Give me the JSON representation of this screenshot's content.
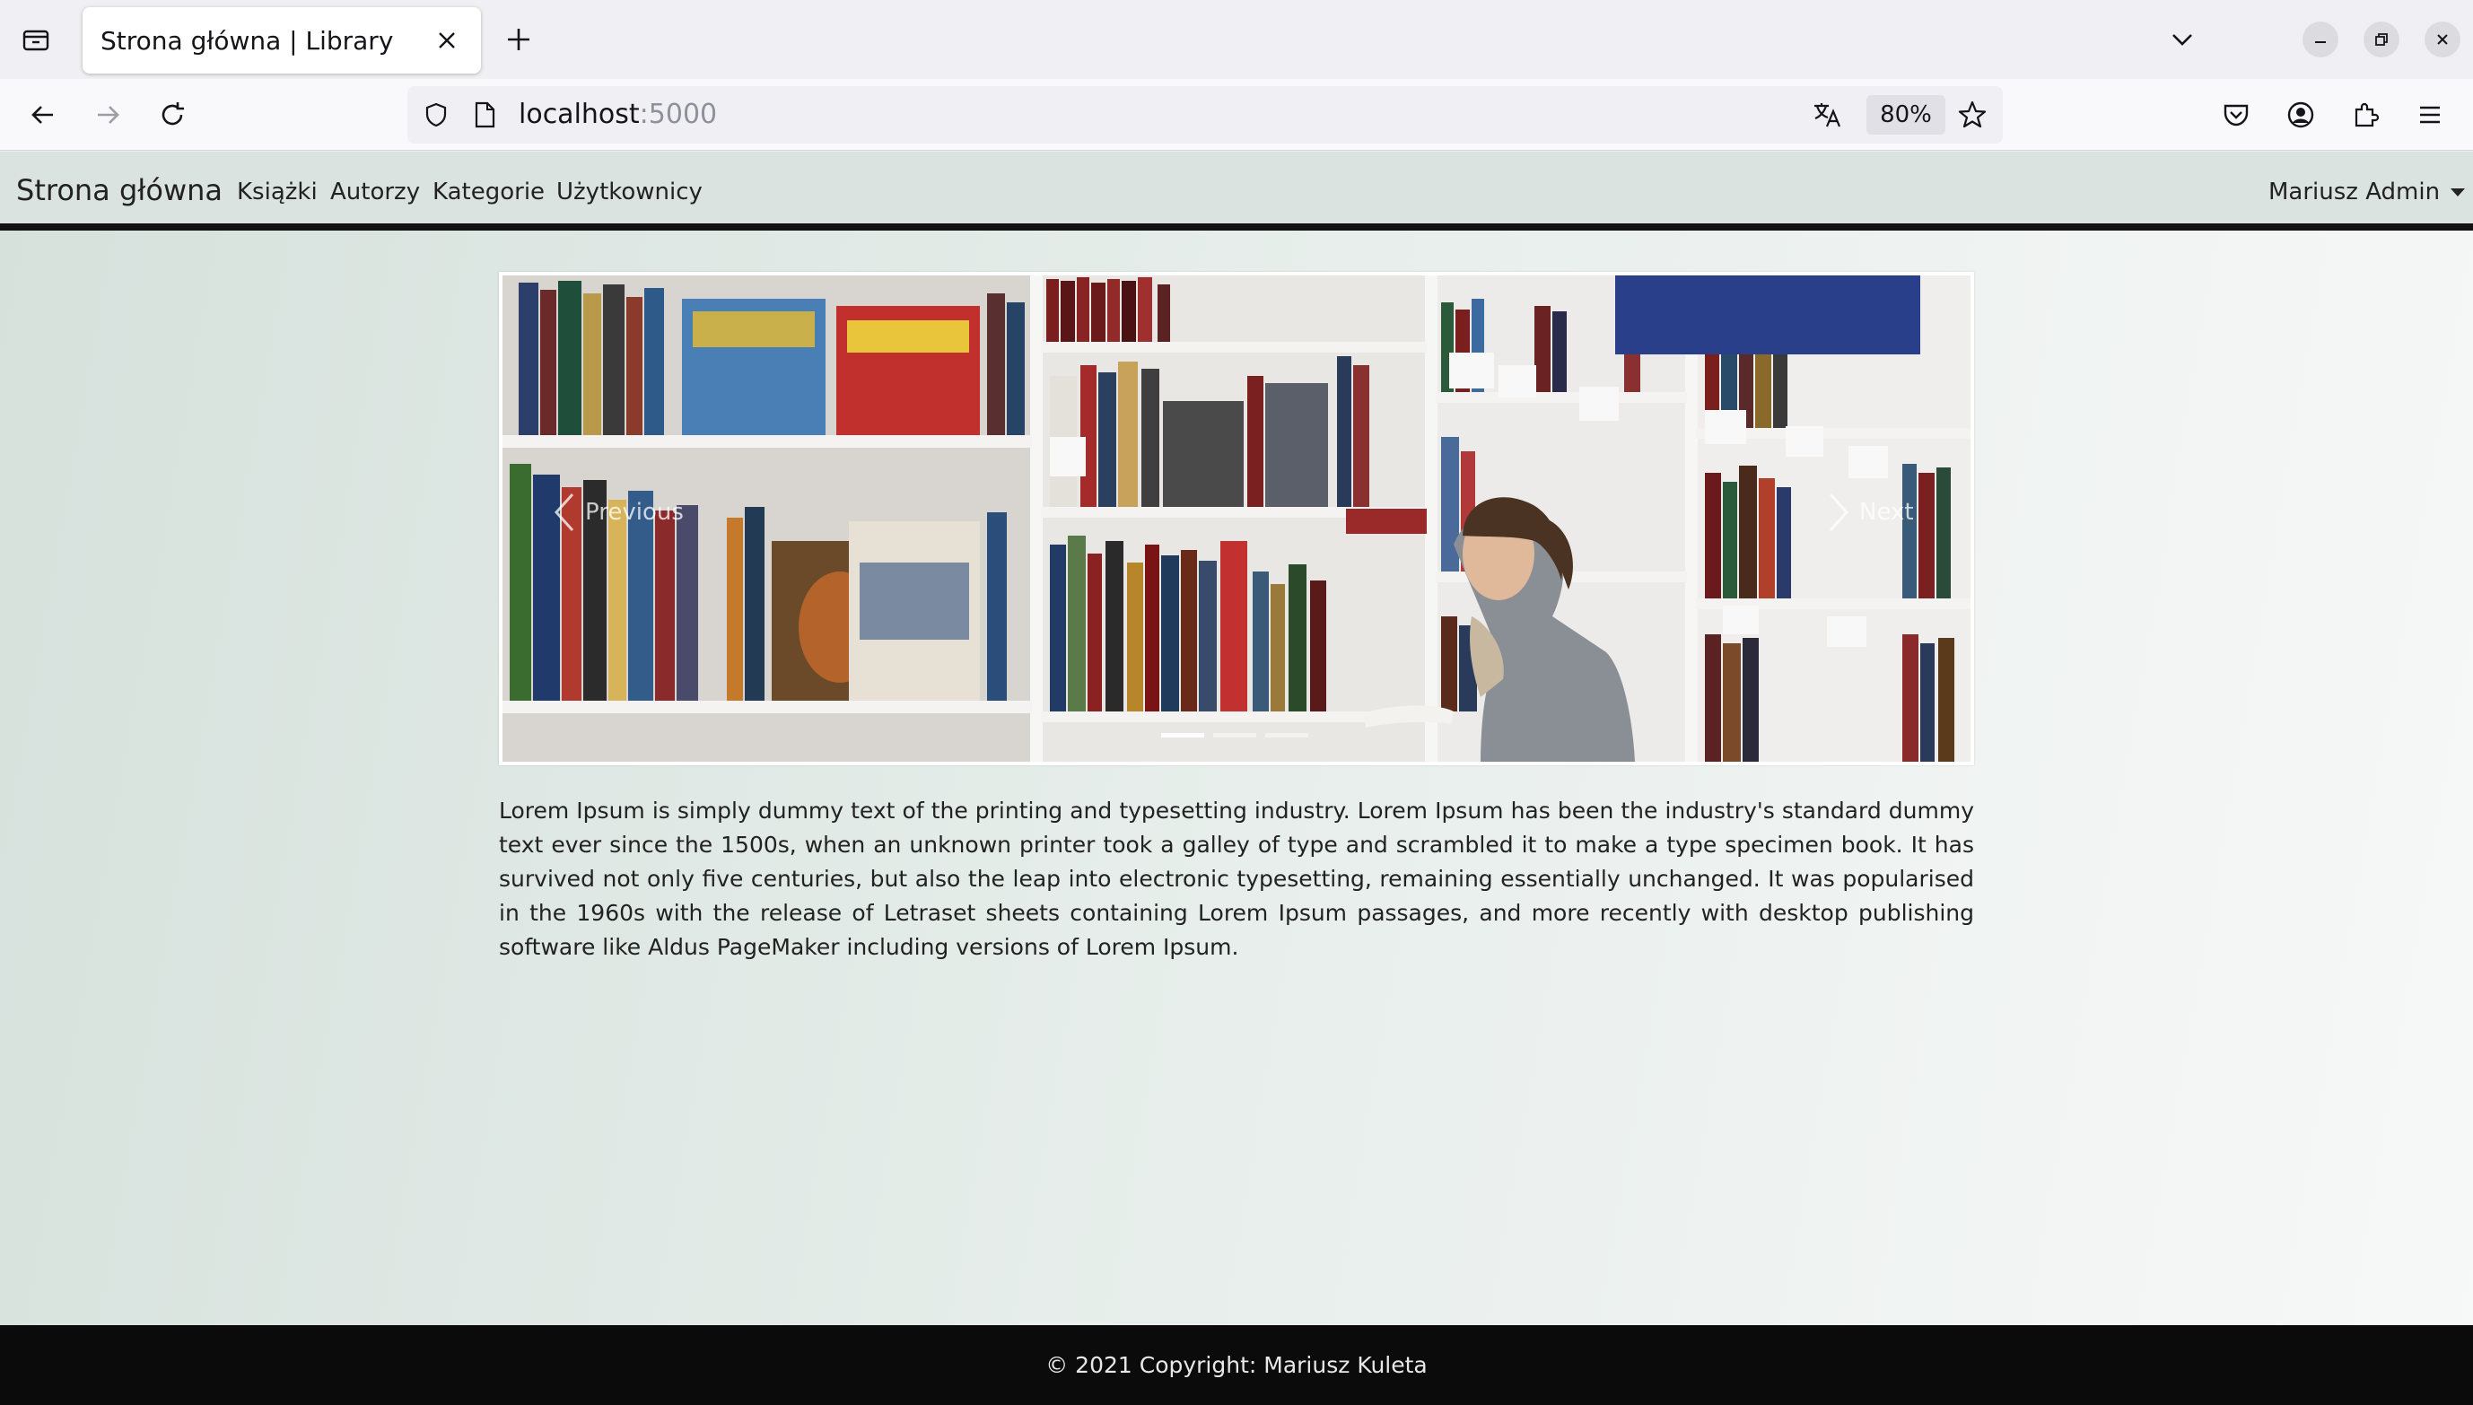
{
  "browser": {
    "tab_title": "Strona główna | Library",
    "url_host": "localhost",
    "url_port": ":5000",
    "zoom": "80%",
    "icons": [
      "tab-list-icon",
      "close-icon",
      "plus-icon",
      "chevron-down-icon",
      "minimize-icon",
      "restore-icon",
      "close-window-icon",
      "back-icon",
      "forward-icon",
      "reload-icon",
      "shield-icon",
      "page-icon",
      "translate-icon",
      "star-icon",
      "pocket-icon",
      "account-icon",
      "extensions-icon",
      "menu-icon"
    ]
  },
  "site": {
    "brand": "Strona główna",
    "nav": [
      "Książki",
      "Autorzy",
      "Kategorie",
      "Użytkownicy"
    ],
    "user": "Mariusz Admin"
  },
  "carousel": {
    "prev_label": "Previous",
    "next_label": "Next",
    "slide_count": 3,
    "active_slide": 1
  },
  "content": {
    "paragraph": "Lorem Ipsum is simply dummy text of the printing and typesetting industry. Lorem Ipsum has been the industry's standard dummy text ever since the 1500s, when an unknown printer took a galley of type and scrambled it to make a type specimen book. It has survived not only five centuries, but also the leap into electronic typesetting, remaining essentially unchanged. It was popularised in the 1960s with the release of Letraset sheets containing Lorem Ipsum passages, and more recently with desktop publishing software like Aldus PageMaker including versions of Lorem Ipsum."
  },
  "footer": {
    "text": "© 2021 Copyright: Mariusz Kuleta"
  }
}
